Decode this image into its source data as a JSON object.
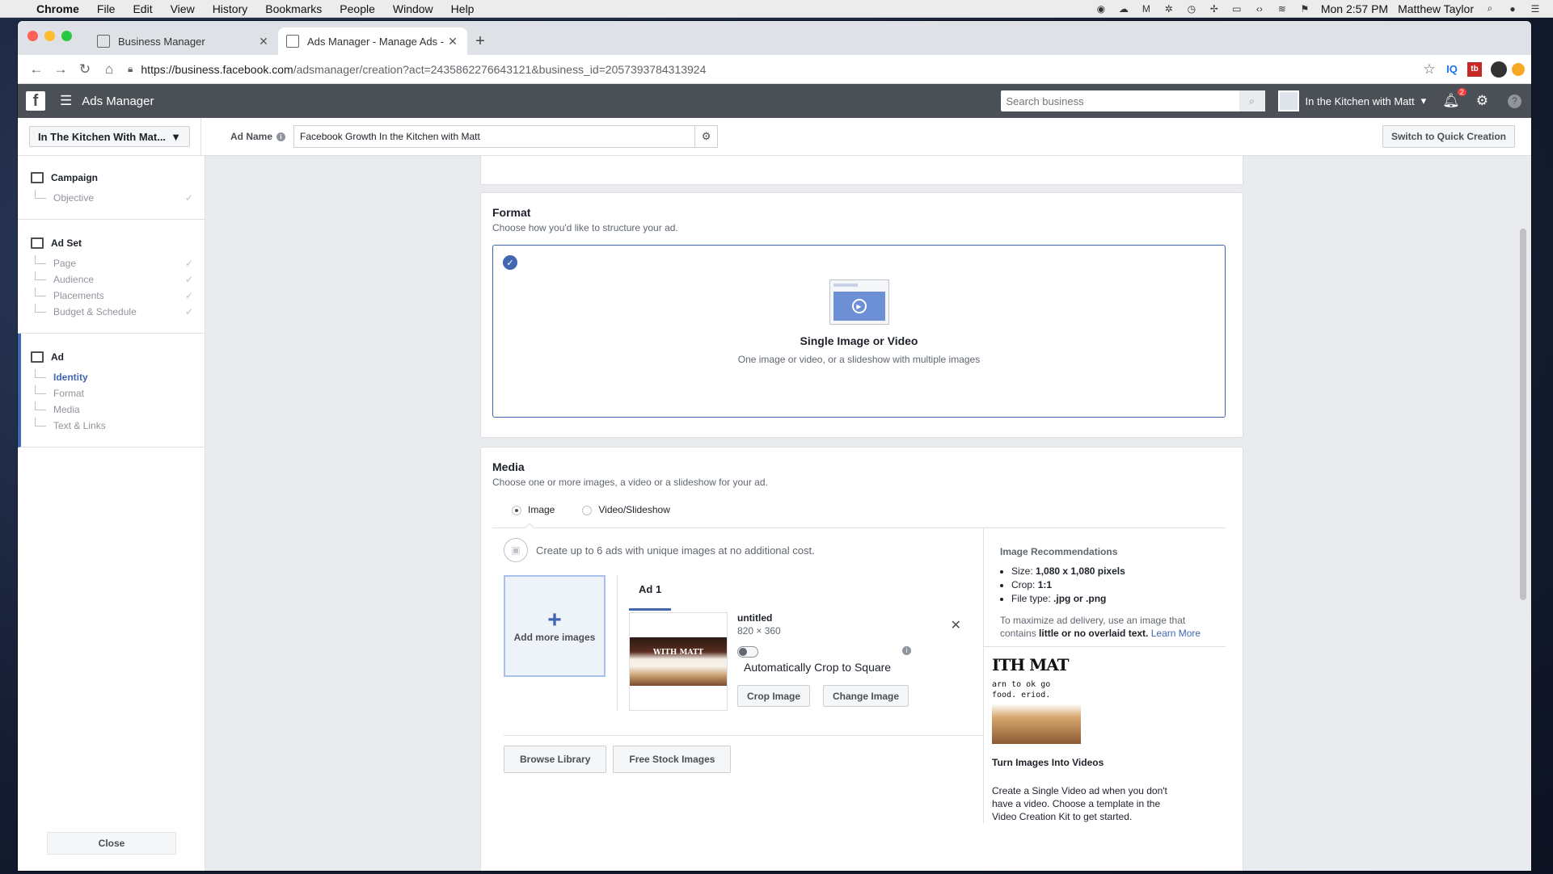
{
  "menubar": {
    "app": "Chrome",
    "menus": [
      "File",
      "Edit",
      "View",
      "History",
      "Bookmarks",
      "People",
      "Window",
      "Help"
    ],
    "clock": "Mon 2:57 PM",
    "user": "Matthew Taylor"
  },
  "browser": {
    "tabs": [
      {
        "title": "Business Manager"
      },
      {
        "title": "Ads Manager - Manage Ads - C"
      }
    ],
    "url_host": "https://business.facebook.com",
    "url_path": "/adsmanager/creation?act=2435862276643121&business_id=2057393784313924"
  },
  "fb": {
    "app_title": "Ads Manager",
    "search_placeholder": "Search business",
    "account_name": "In the Kitchen with Matt",
    "notification_count": "2"
  },
  "subheader": {
    "account_select": "In The Kitchen With Mat...",
    "ad_name_label": "Ad Name",
    "ad_name_value": "Facebook Growth In the Kitchen with Matt",
    "quick_creation": "Switch to Quick Creation"
  },
  "sidebar": {
    "campaign": {
      "title": "Campaign",
      "items": [
        "Objective"
      ]
    },
    "adset": {
      "title": "Ad Set",
      "items": [
        "Page",
        "Audience",
        "Placements",
        "Budget & Schedule"
      ]
    },
    "ad": {
      "title": "Ad",
      "items": [
        "Identity",
        "Format",
        "Media",
        "Text & Links"
      ]
    },
    "close": "Close"
  },
  "format": {
    "title": "Format",
    "subtitle": "Choose how you'd like to structure your ad.",
    "option_name": "Single Image or Video",
    "option_desc": "One image or video, or a slideshow with multiple images"
  },
  "media": {
    "title": "Media",
    "subtitle": "Choose one or more images, a video or a slideshow for your ad.",
    "tab_image": "Image",
    "tab_video": "Video/Slideshow",
    "upsell": "Create up to 6 ads with unique images at no additional cost.",
    "add_more": "Add more images",
    "ad_tab": "Ad 1",
    "file_name": "untitled",
    "file_dims": "820 × 360",
    "auto_crop": "Automatically Crop to Square",
    "crop_btn": "Crop Image",
    "change_btn": "Change Image",
    "browse_btn": "Browse Library",
    "stock_btn": "Free Stock Images",
    "thumb_caption": "WITH MATT"
  },
  "recommendations": {
    "title": "Image Recommendations",
    "size_label": "Size: ",
    "size_value": "1,080 x 1,080 pixels",
    "crop_label": "Crop: ",
    "crop_value": "1:1",
    "type_label": "File type: ",
    "type_value": ".jpg or .png",
    "note_pre": "To maximize ad delivery, use an image that contains ",
    "note_bold": "little or no overlaid text.",
    "note_link": "Learn More",
    "video_title": "Turn Images Into Videos",
    "video_desc": "Create a Single Video ad when you don't have a video. Choose a template in the Video Creation Kit to get started.",
    "illus_big": "ITH MAT",
    "illus_small": "arn to ok go\nfood. eriod."
  }
}
